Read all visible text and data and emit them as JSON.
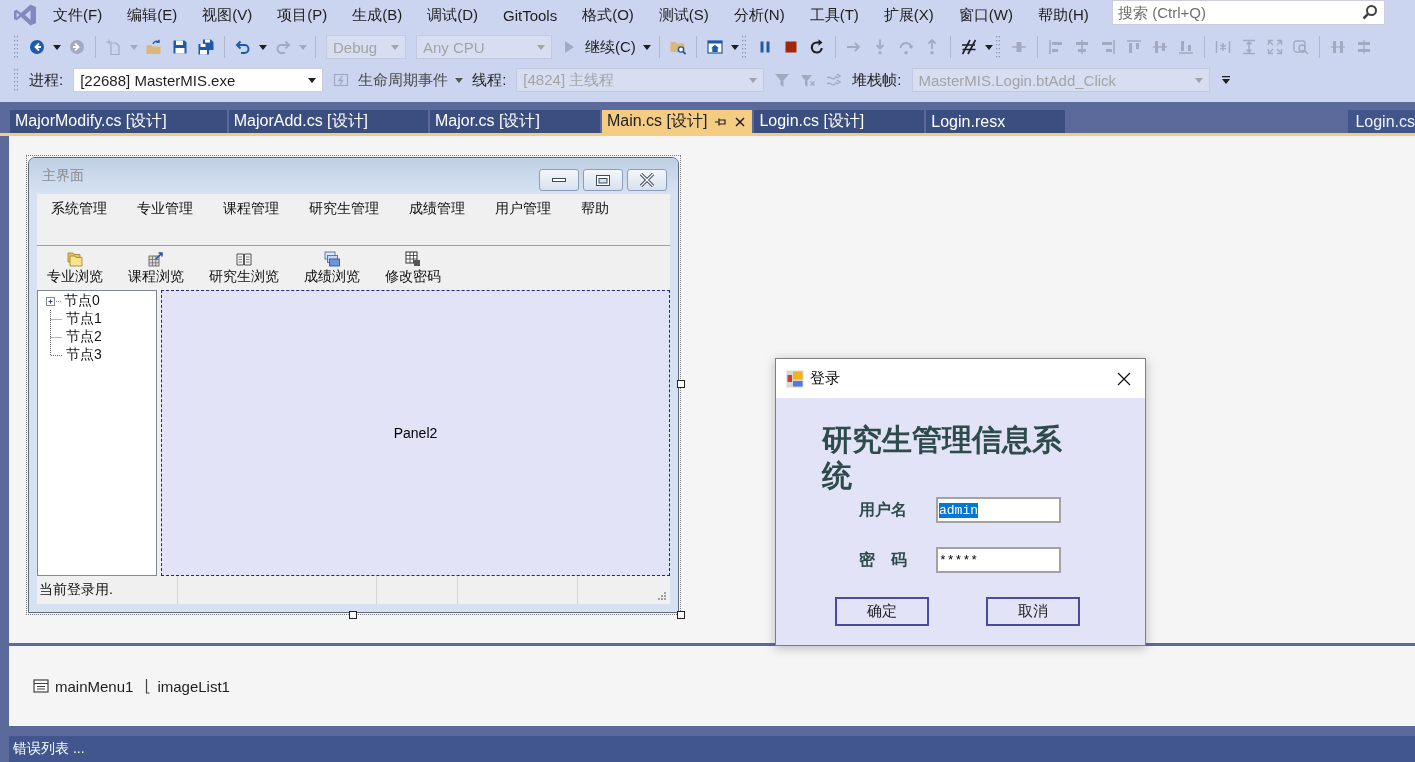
{
  "menu_bar": {
    "items": [
      "文件(F)",
      "编辑(E)",
      "视图(V)",
      "项目(P)",
      "生成(B)",
      "调试(D)",
      "GitTools",
      "格式(O)",
      "测试(S)",
      "分析(N)",
      "工具(T)",
      "扩展(X)",
      "窗口(W)",
      "帮助(H)"
    ]
  },
  "search": {
    "placeholder": "搜索 (Ctrl+Q)"
  },
  "toolbar": {
    "bands": [
      {
        "groups": [
          [
            {
              "kind": "back",
              "disabled": false
            },
            {
              "kind": "caret",
              "disabled": false
            },
            {
              "kind": "forward",
              "disabled": true
            }
          ],
          [
            {
              "kind": "new",
              "disabled": true
            },
            {
              "kind": "caret",
              "disabled": true
            },
            {
              "kind": "open",
              "disabled": false
            },
            {
              "kind": "save",
              "disabled": false
            },
            {
              "kind": "save-all",
              "disabled": false
            }
          ],
          [
            {
              "kind": "undo",
              "disabled": false
            },
            {
              "kind": "caret",
              "disabled": false
            },
            {
              "kind": "redo",
              "disabled": true
            },
            {
              "kind": "caret",
              "disabled": true
            }
          ],
          [
            {
              "kind": "combo",
              "value": "Debug",
              "disabled": true
            },
            {
              "kind": "combo",
              "value": "Any CPU",
              "disabled": true
            },
            {
              "kind": "run",
              "label": "继续(C)",
              "disabled": false
            },
            {
              "kind": "caret",
              "disabled": false
            }
          ],
          [
            {
              "kind": "find",
              "disabled": false
            }
          ],
          [
            {
              "kind": "browser",
              "disabled": false
            },
            {
              "kind": "caret",
              "disabled": false
            }
          ]
        ]
      },
      {
        "groups": [
          [
            {
              "kind": "pause",
              "disabled": false
            },
            {
              "kind": "stop",
              "disabled": false
            },
            {
              "kind": "restart",
              "disabled": false
            }
          ],
          [
            {
              "kind": "step-next",
              "disabled": true
            },
            {
              "kind": "step-into",
              "disabled": true
            },
            {
              "kind": "step-over",
              "disabled": true
            },
            {
              "kind": "step-out",
              "disabled": true
            }
          ],
          [
            {
              "kind": "hex",
              "disabled": false
            },
            {
              "kind": "caret",
              "disabled": false
            }
          ]
        ]
      },
      {
        "groups": [
          [
            {
              "kind": "tee",
              "disabled": true
            }
          ],
          [
            {
              "kind": "align-left",
              "disabled": true
            },
            {
              "kind": "align-center",
              "disabled": true
            },
            {
              "kind": "align-right",
              "disabled": true
            },
            {
              "kind": "align-top",
              "disabled": true
            },
            {
              "kind": "align-middle",
              "disabled": true
            },
            {
              "kind": "align-bottom",
              "disabled": true
            }
          ],
          [
            {
              "kind": "spacing",
              "disabled": true
            },
            {
              "kind": "height",
              "disabled": true
            },
            {
              "kind": "expand",
              "disabled": true
            },
            {
              "kind": "zoom",
              "disabled": true
            }
          ],
          [
            {
              "kind": "v-bars",
              "disabled": true
            },
            {
              "kind": "h-bars",
              "disabled": true
            }
          ]
        ]
      }
    ]
  },
  "debug_location": {
    "items": [
      {
        "kind": "label",
        "text": "进程:"
      },
      {
        "kind": "combo",
        "value": "[22688] MasterMIS.exe",
        "disabled": false
      },
      {
        "kind": "lifecycle",
        "disabled": true
      },
      {
        "kind": "menu",
        "label": "生命周期事件"
      },
      {
        "kind": "label",
        "text": "线程:"
      },
      {
        "kind": "combo",
        "value": "[4824] 主线程",
        "disabled": true
      },
      {
        "kind": "filter",
        "disabled": true
      },
      {
        "kind": "filter-clear",
        "disabled": true
      },
      {
        "kind": "thread-flag",
        "disabled": true
      },
      {
        "kind": "label",
        "text": "堆栈帧:"
      },
      {
        "kind": "combo",
        "value": "MasterMIS.Login.btAdd_Click",
        "disabled": true
      },
      {
        "kind": "overflow"
      }
    ]
  },
  "tabs": [
    {
      "label": "MajorModify.cs [设计]",
      "selected": false
    },
    {
      "label": "MajorAdd.cs [设计]",
      "selected": false
    },
    {
      "label": "Major.cs [设计]",
      "selected": false
    },
    {
      "label": "Main.cs [设计]",
      "selected": true
    },
    {
      "label": "Login.cs [设计]",
      "selected": false
    },
    {
      "label": "Login.resx",
      "selected": false
    }
  ],
  "side_tab": {
    "label": "Login.cs"
  },
  "main_form": {
    "title": "主界面",
    "menu": [
      "系统管理",
      "专业管理",
      "课程管理",
      "研究生管理",
      "成绩管理",
      "用户管理",
      "帮助"
    ],
    "toolbar": [
      {
        "kind": "folders",
        "label": "专业浏览"
      },
      {
        "kind": "course",
        "label": "课程浏览"
      },
      {
        "kind": "book",
        "label": "研究生浏览"
      },
      {
        "kind": "windows",
        "label": "成绩浏览"
      },
      {
        "kind": "grid",
        "label": "修改密码"
      }
    ],
    "tree": [
      {
        "label": "节点0",
        "kind": "collapsed"
      },
      {
        "label": "节点1",
        "kind": "leaf"
      },
      {
        "label": "节点2",
        "kind": "leaf"
      },
      {
        "label": "节点3",
        "kind": "leaf"
      }
    ],
    "panel": {
      "label": "Panel2"
    },
    "status": {
      "label": "当前登录用."
    }
  },
  "login_dialog": {
    "title": "登录",
    "heading": "研究生管理信息系统",
    "fields": [
      {
        "label": "用户名",
        "value": "admin",
        "selected": true
      },
      {
        "label": "密　码",
        "value": "*****",
        "selected": false
      }
    ],
    "buttons": [
      "确定",
      "取消"
    ]
  },
  "component_tray": [
    {
      "kind": "menu",
      "label": "mainMenu1"
    },
    {
      "kind": "image-list",
      "label": "imageList1"
    }
  ],
  "status_bar": {
    "text": "错误列表 ..."
  }
}
